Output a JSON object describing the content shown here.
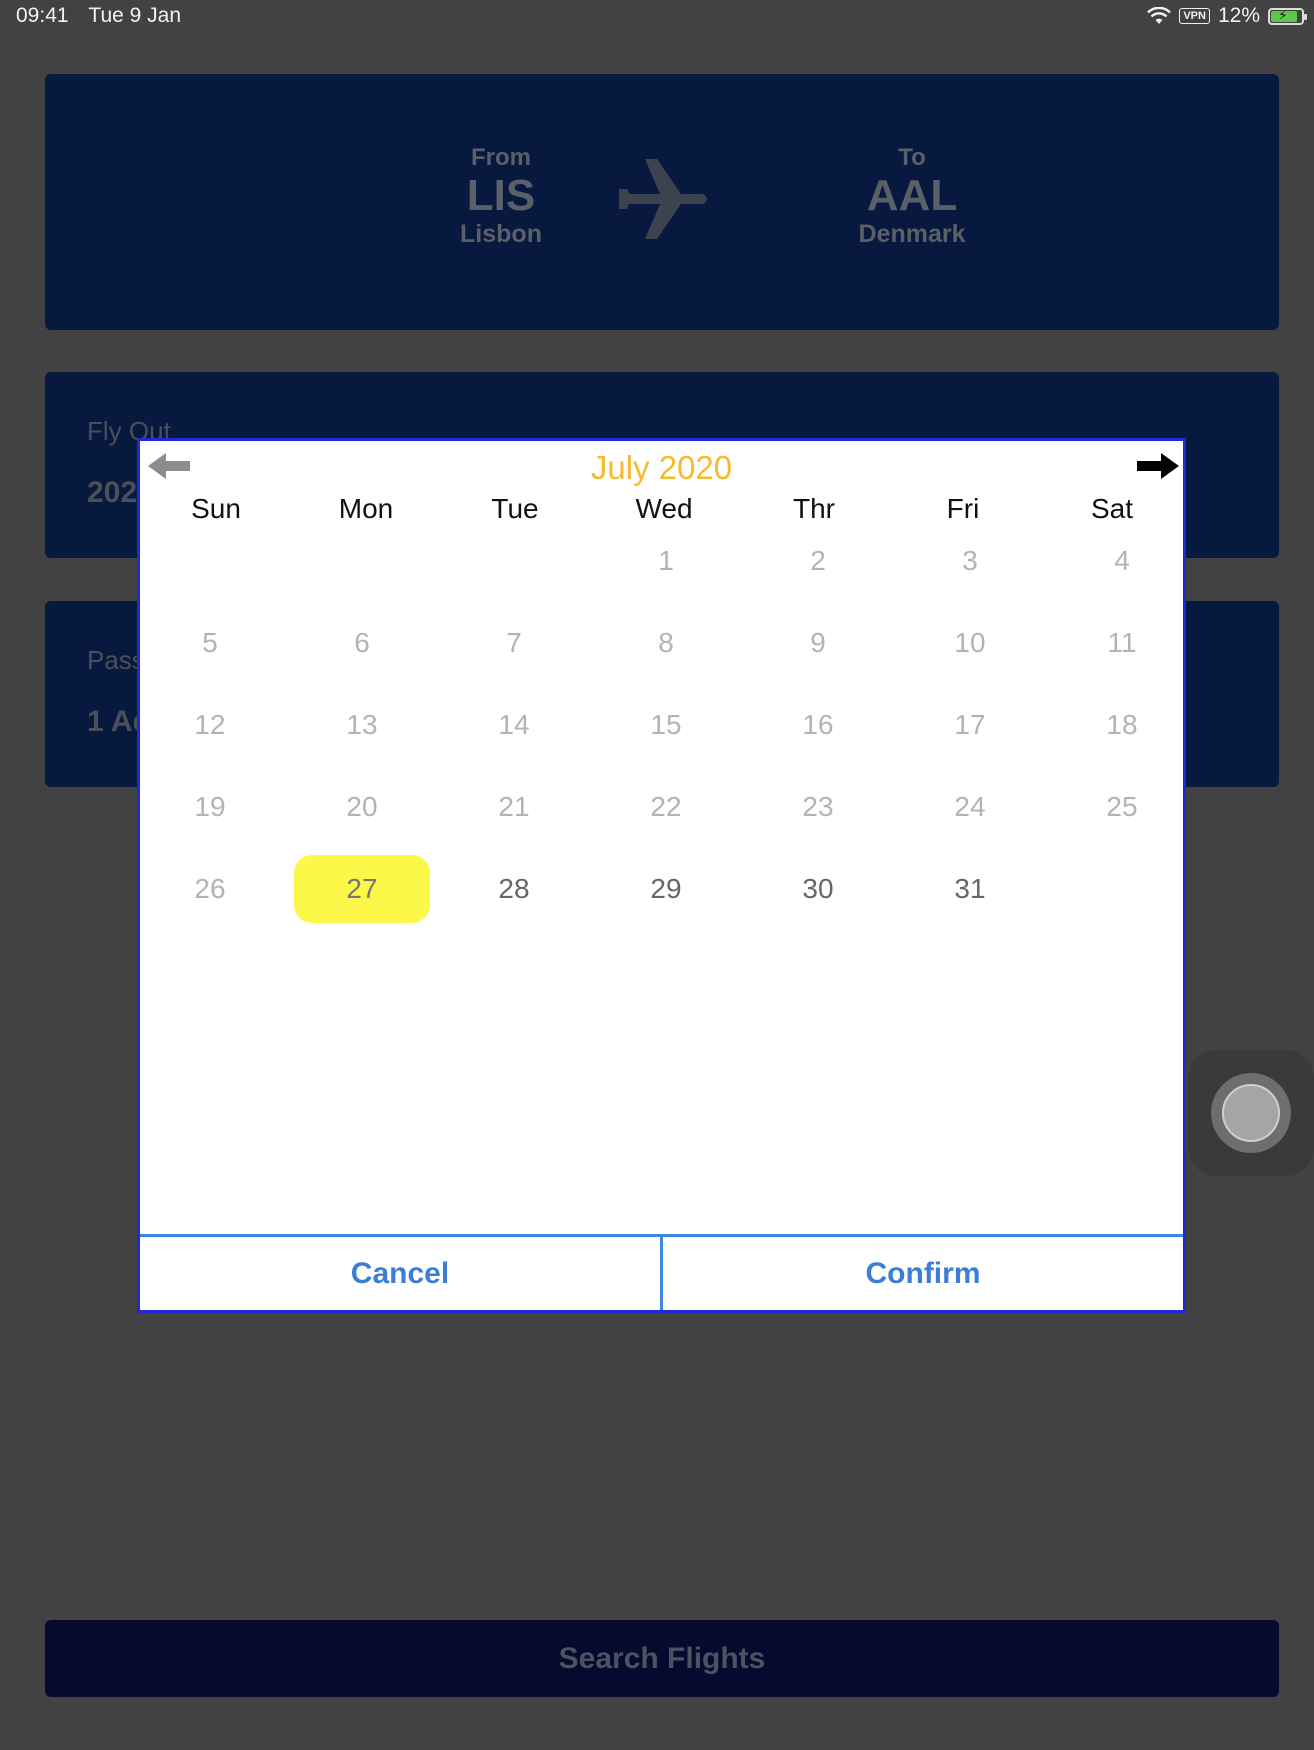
{
  "status_bar": {
    "time": "09:41",
    "date": "Tue 9 Jan",
    "vpn": "VPN",
    "battery": "12%"
  },
  "route": {
    "from": {
      "label": "From",
      "code": "LIS",
      "city": "Lisbon"
    },
    "to": {
      "label": "To",
      "code": "AAL",
      "city": "Denmark"
    }
  },
  "fly_out": {
    "label": "Fly Out",
    "value": "202"
  },
  "passengers": {
    "label": "Pass",
    "value": "1 Ad"
  },
  "search_button": "Search Flights",
  "calendar": {
    "month_title": "July 2020",
    "weekdays": [
      "Sun",
      "Mon",
      "Tue",
      "Wed",
      "Thr",
      "Fri",
      "Sat"
    ],
    "first_weekday_index": 3,
    "days_in_month": 31,
    "selected_day": 27,
    "first_enabled_day": 27,
    "cancel_label": "Cancel",
    "confirm_label": "Confirm",
    "colors": {
      "title": "#f5bb2d",
      "selected": "#fbf84a",
      "border": "#1c2bd6",
      "button_text": "#3a7fd5"
    },
    "icons": {
      "prev": "arrow-left-icon",
      "next": "arrow-right-icon"
    }
  }
}
